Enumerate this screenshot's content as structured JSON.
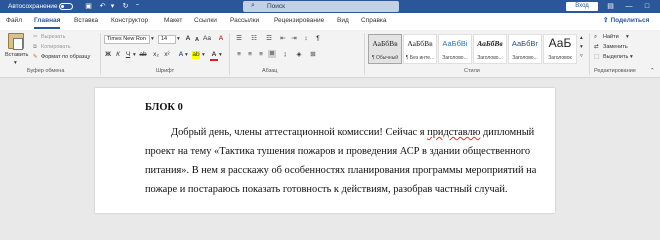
{
  "titlebar": {
    "autosave_label": "Автосохранение",
    "search_placeholder": "Поиск",
    "signin_label": "Вход",
    "minimize": "—",
    "restore": "□"
  },
  "menu": {
    "tabs": [
      "Файл",
      "Главная",
      "Вставка",
      "Конструктор",
      "Макет",
      "Ссылки",
      "Рассылки",
      "Рецензирование",
      "Вид",
      "Справка"
    ],
    "active_tab": "Главная",
    "share_label": "Поделиться"
  },
  "ribbon": {
    "clipboard": {
      "paste_label": "Вставить",
      "cut_label": "Вырезать",
      "copy_label": "Копировать",
      "format_painter_label": "Формат по образцу",
      "group_label": "Буфер обмена"
    },
    "font": {
      "font_name": "Times New Ron",
      "font_size": "14",
      "group_label": "Шрифт"
    },
    "paragraph": {
      "group_label": "Абзац"
    },
    "styles": {
      "items": [
        {
          "preview": "АаБбВв",
          "name": "¶ Обычный"
        },
        {
          "preview": "АаБбВв",
          "name": "¶ Без инте..."
        },
        {
          "preview": "АаБбВі",
          "name": "Заголово..."
        },
        {
          "preview": "АаБбВв",
          "name": "Заголово..."
        },
        {
          "preview": "АаБбВг",
          "name": "Заголово..."
        },
        {
          "preview": "АаБ",
          "name": "Заголовок"
        }
      ],
      "group_label": "Стили"
    },
    "editing": {
      "find_label": "Найти",
      "replace_label": "Заменить",
      "select_label": "Выделить",
      "group_label": "Редактирование"
    }
  },
  "document": {
    "heading": "БЛОК 0",
    "line1_before": "Добрый день, члены аттестационной комиссии! Сейчас я ",
    "line1_misspelled": "придставлю",
    "line1_after": " дипломный",
    "line2": "проект на тему «Тактика тушения пожаров и проведения АСР в здании общественного",
    "line3": "питания». В нем я расскажу об особенностях планирования программы мероприятий на",
    "line4": "пожаре и постараюсь показать готовность к действиям, разобрав частный случай."
  },
  "colors": {
    "accent": "#2b579a",
    "highlight": "#ffff00",
    "font_color": "#e02020"
  }
}
